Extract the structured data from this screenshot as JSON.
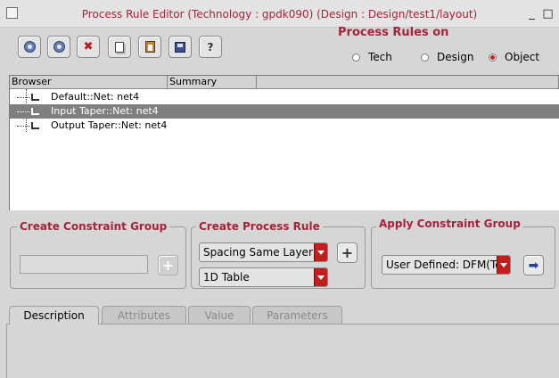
{
  "window": {
    "title": "Process Rule Editor (Technology : gpdk090) (Design : Design/test1/layout)",
    "controls": [
      "_",
      "□"
    ]
  },
  "toolbar": {
    "buttons": [
      {
        "name": "move-up",
        "icon": "arrow-up-icon"
      },
      {
        "name": "move-down",
        "icon": "arrow-down-icon"
      },
      {
        "name": "delete",
        "icon": "delete-icon",
        "glyph": "✖"
      },
      {
        "name": "copy",
        "icon": "copy-icon"
      },
      {
        "name": "paste",
        "icon": "paste-icon"
      },
      {
        "name": "save",
        "icon": "save-icon"
      },
      {
        "name": "help",
        "icon": "help-icon",
        "glyph": "?"
      }
    ]
  },
  "process_rules_on": {
    "title": "Process Rules on",
    "options": [
      "Tech",
      "Design",
      "Object"
    ],
    "selected": "Object"
  },
  "browser": {
    "columns": [
      "Browser",
      "Summary"
    ],
    "rows": [
      {
        "label": "Default::Net: net4",
        "selected": false
      },
      {
        "label": "Input Taper::Net: net4",
        "selected": true
      },
      {
        "label": "Output Taper::Net: net4",
        "selected": false
      }
    ]
  },
  "create_constraint_group": {
    "title": "Create Constraint Group",
    "name_value": "",
    "add_glyph": "+"
  },
  "create_process_rule": {
    "title": "Create Process Rule",
    "rule_select": "Spacing Same Layer",
    "table_select": "1D Table",
    "add_glyph": "+"
  },
  "apply_constraint_group": {
    "title": "Apply Constraint Group",
    "group_select": "User Defined: DFM(Te",
    "apply_glyph": "➡"
  },
  "tabs": [
    {
      "label": "Description",
      "active": true
    },
    {
      "label": "Attributes",
      "active": false
    },
    {
      "label": "Value",
      "active": false
    },
    {
      "label": "Parameters",
      "active": false
    }
  ],
  "colors": {
    "accent": "#a6233b",
    "combo_arrow": "#c31d1d",
    "selection": "#7f7f7f"
  }
}
